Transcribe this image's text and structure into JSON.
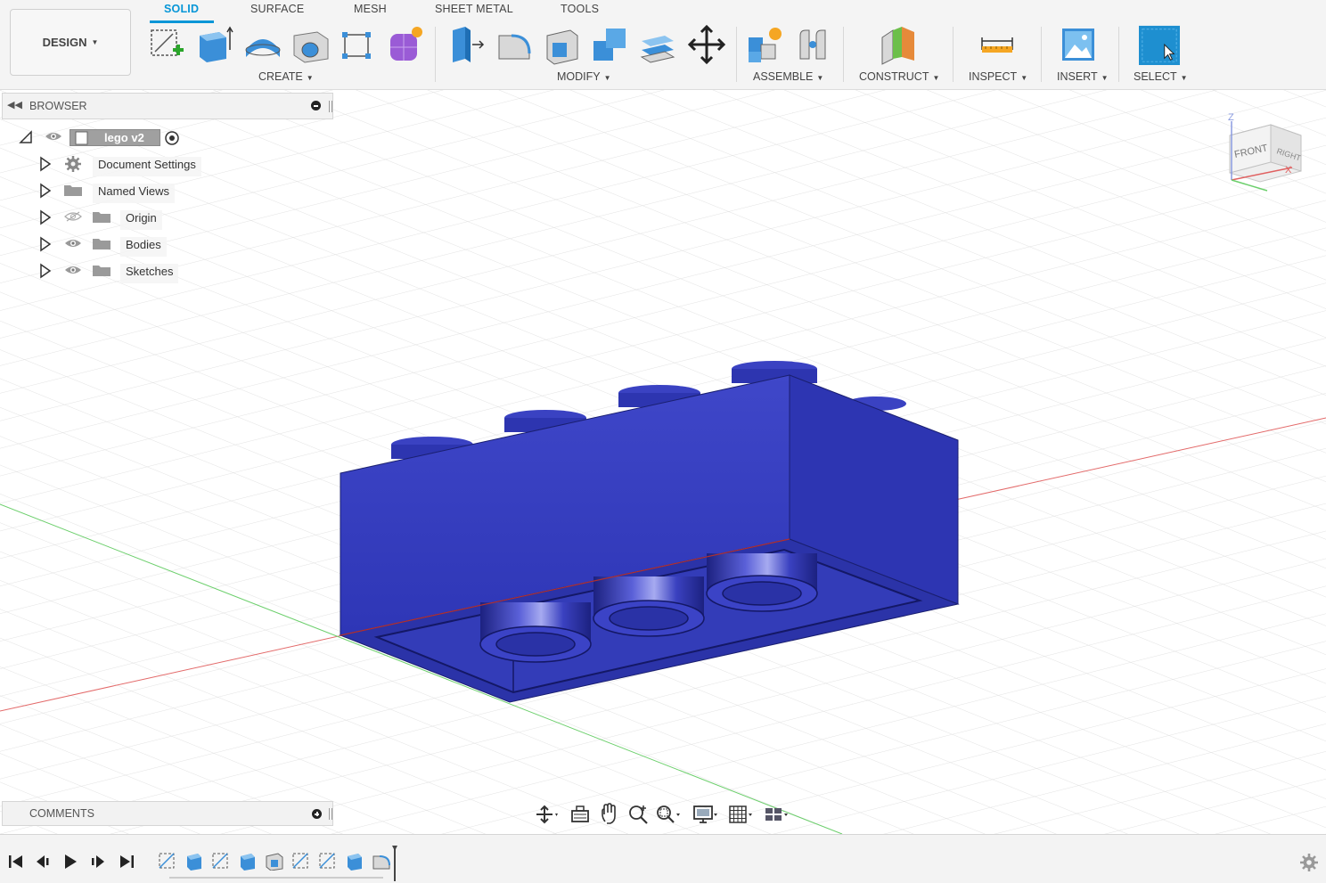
{
  "workspace": {
    "label": "DESIGN"
  },
  "tabs": [
    {
      "label": "SOLID",
      "active": true
    },
    {
      "label": "SURFACE",
      "active": false
    },
    {
      "label": "MESH",
      "active": false
    },
    {
      "label": "SHEET METAL",
      "active": false
    },
    {
      "label": "TOOLS",
      "active": false
    }
  ],
  "groups": {
    "create": "CREATE",
    "modify": "MODIFY",
    "assemble": "ASSEMBLE",
    "construct": "CONSTRUCT",
    "inspect": "INSPECT",
    "insert": "INSERT",
    "select": "SELECT"
  },
  "browser": {
    "title": "BROWSER",
    "root": "lego v2",
    "items": [
      {
        "label": "Document Settings",
        "icon": "gear-icon"
      },
      {
        "label": "Named Views",
        "icon": "folder-icon"
      },
      {
        "label": "Origin",
        "icon": "folder-icon",
        "visibility": "hidden"
      },
      {
        "label": "Bodies",
        "icon": "folder-icon",
        "visibility": "visible"
      },
      {
        "label": "Sketches",
        "icon": "folder-icon",
        "visibility": "visible"
      }
    ]
  },
  "comments": {
    "title": "COMMENTS"
  },
  "viewcube": {
    "front": "FRONT",
    "right": "RIGHT",
    "axis_z": "Z",
    "axis_x": "X"
  },
  "colors": {
    "accent": "#0696d7",
    "body": "#2f37b8",
    "axis_x": "#e05a5a",
    "axis_y": "#5ec45e"
  }
}
